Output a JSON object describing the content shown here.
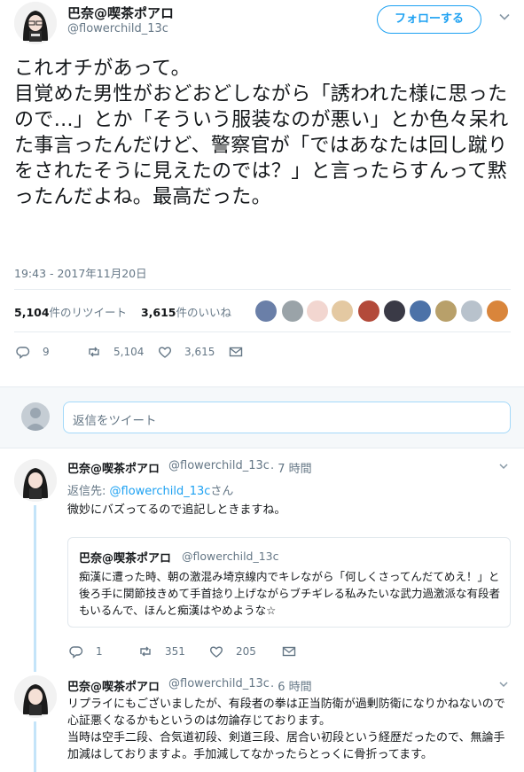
{
  "main_tweet": {
    "author_name": "巴奈@喫茶ポアロ",
    "author_handle": "@flowerchild_13c",
    "follow_label": "フォローする",
    "text": "これオチがあって。\n目覚めた男性がおどおどしながら「誘われた様に思ったので…」とか「そういう服装なのが悪い」とか色々呆れた事言ったんだけど、警察官が「ではあなたは回し蹴りをされたそうに見えたのでは？」と言ったらすんって黙ったんだよね。最高だった。",
    "timestamp": "19:43 - 2017年11月20日",
    "retweet_count": "5,104",
    "retweet_label": "件のリツイート",
    "like_count": "3,615",
    "like_label": "件のいいね",
    "actions": {
      "reply": "9",
      "retweet": "5,104",
      "like": "3,615"
    }
  },
  "composer": {
    "placeholder": "返信をツイート"
  },
  "replies": [
    {
      "author_name": "巴奈@喫茶ポアロ",
      "author_handle": "@flowerchild_13c",
      "time": "· 7 時間",
      "replying_prefix": "返信先: ",
      "replying_handle": "@flowerchild_13c",
      "replying_suffix": "さん",
      "text": "微妙にバズってるので追記しときますね。",
      "quote": {
        "author_name": "巴奈@喫茶ポアロ",
        "author_handle": "@flowerchild_13c",
        "text": "痴漢に遭った時、朝の激混み埼京線内でキレながら「何しくさってんだてめえ！」と後ろ手に関節技きめて手首捻り上げながらブチギレる私みたいな武力過激派な有段者もいるんで、ほんと痴漢はやめような☆"
      },
      "actions": {
        "reply": "1",
        "retweet": "351",
        "like": "205"
      }
    },
    {
      "author_name": "巴奈@喫茶ポアロ",
      "author_handle": "@flowerchild_13c",
      "time": "· 6 時間",
      "text": "リプライにもございましたが、有段者の拳は正当防衛が過剰防衛になりかねないので心証悪くなるかもというのは勿論存じております。\n当時は空手二段、合気道初段、剣道三段、居合い初段という経歴だったので、無論手加減はしておりますよ。手加減してなかったらとっくに骨折ってます。"
    }
  ],
  "colors": {
    "accent": "#1da1f2",
    "muted": "#657786",
    "border": "#e6ecf0"
  },
  "icons": [
    "chevron-down-icon",
    "reply-icon",
    "retweet-icon",
    "heart-icon",
    "mail-icon"
  ]
}
